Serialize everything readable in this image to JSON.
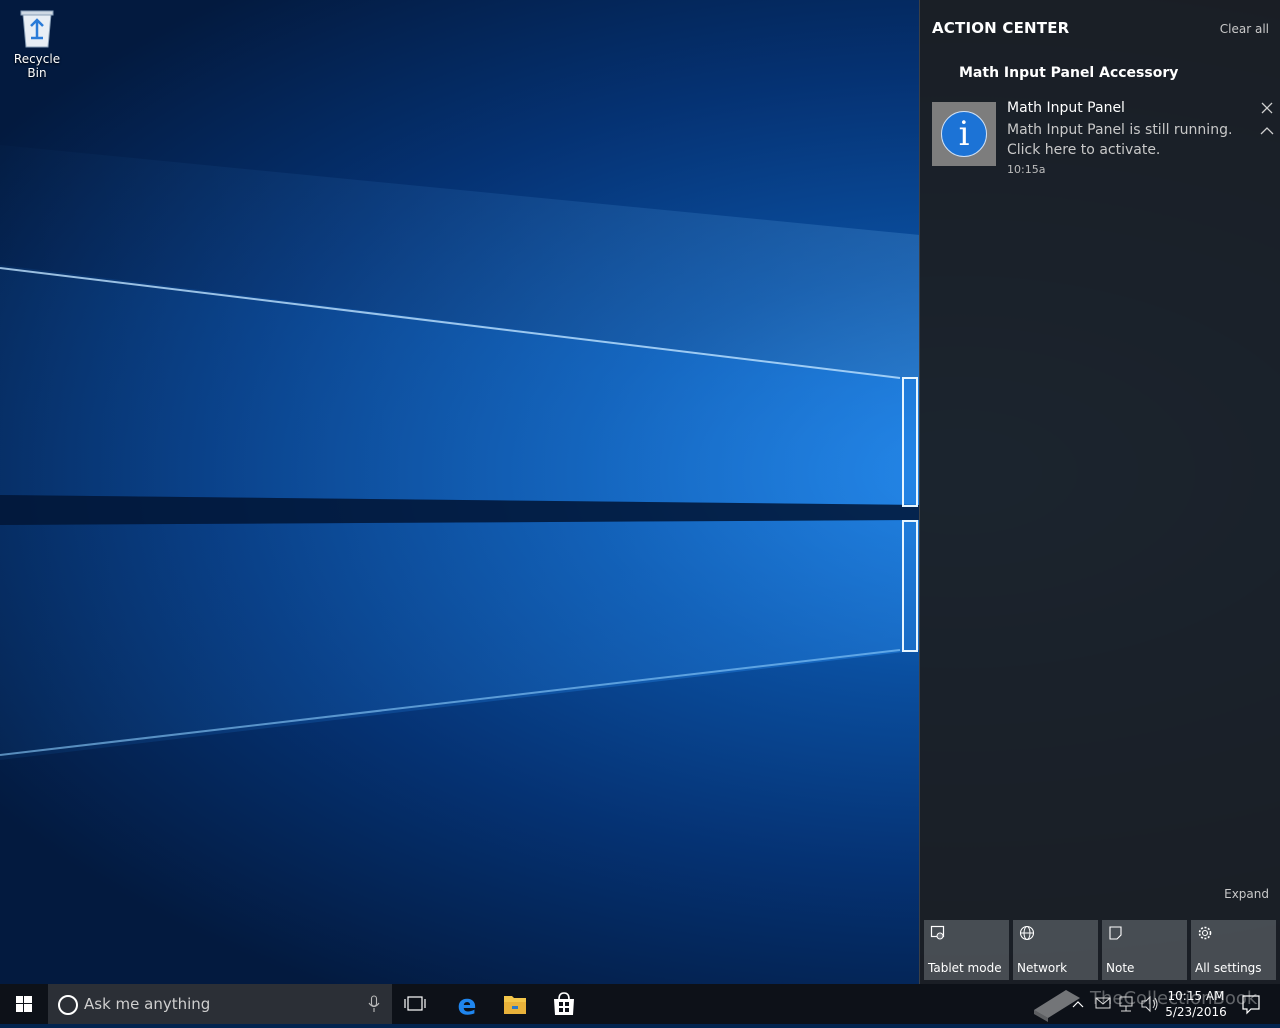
{
  "desktop": {
    "icons": [
      {
        "label": "Recycle Bin",
        "icon": "recycle-bin-icon"
      }
    ]
  },
  "action_center": {
    "title": "ACTION CENTER",
    "clear_all": "Clear all",
    "group_title": "Math Input Panel Accessory",
    "notification": {
      "title": "Math Input Panel",
      "body_line1": "Math Input Panel is still running.",
      "body_line2": "Click here to activate.",
      "time": "10:15a",
      "icon": "info-icon"
    },
    "expand": "Expand",
    "quick_actions": [
      {
        "label": "Tablet mode",
        "icon": "tablet-mode-icon"
      },
      {
        "label": "Network",
        "icon": "network-globe-icon"
      },
      {
        "label": "Note",
        "icon": "note-icon"
      },
      {
        "label": "All settings",
        "icon": "gear-icon"
      }
    ]
  },
  "taskbar": {
    "search_placeholder": "Ask me anything",
    "pinned": [
      "task-view-icon",
      "edge-icon",
      "file-explorer-icon",
      "store-icon"
    ],
    "clock": {
      "time": "10:15 AM",
      "date": "5/23/2016"
    },
    "watermark": "TheCollectionBook"
  },
  "colors": {
    "accent": "#1c73d6",
    "taskbar": "#0d1118",
    "action_center_bg": "#1c1e21"
  }
}
